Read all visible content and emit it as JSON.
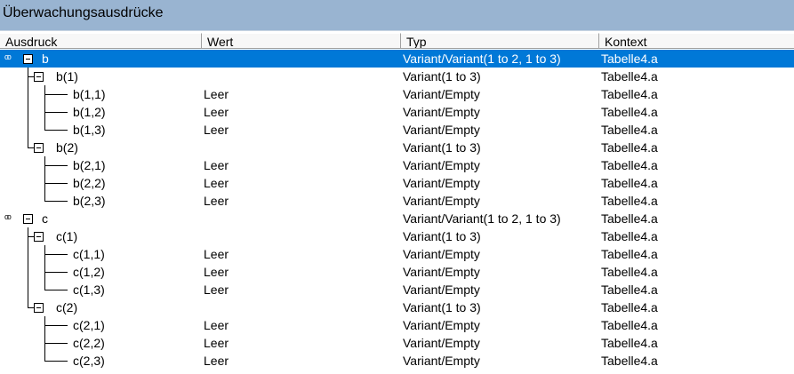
{
  "window": {
    "title": "Überwachungsausdrücke"
  },
  "columns": [
    "Ausdruck",
    "Wert",
    "Typ",
    "Kontext"
  ],
  "glasses_glyph": "ᵒᵒ",
  "rows": [
    {
      "name": "b",
      "value": "",
      "type": "Variant/Variant(1 to 2, 1 to 3)",
      "context": "Tabelle4.a",
      "level": 0,
      "selected": true
    },
    {
      "name": "b(1)",
      "value": "",
      "type": "Variant(1 to 3)",
      "context": "Tabelle4.a",
      "level": 1
    },
    {
      "name": "b(1,1)",
      "value": "Leer",
      "type": "Variant/Empty",
      "context": "Tabelle4.a",
      "level": 2
    },
    {
      "name": "b(1,2)",
      "value": "Leer",
      "type": "Variant/Empty",
      "context": "Tabelle4.a",
      "level": 2
    },
    {
      "name": "b(1,3)",
      "value": "Leer",
      "type": "Variant/Empty",
      "context": "Tabelle4.a",
      "level": 2
    },
    {
      "name": "b(2)",
      "value": "",
      "type": "Variant(1 to 3)",
      "context": "Tabelle4.a",
      "level": 1
    },
    {
      "name": "b(2,1)",
      "value": "Leer",
      "type": "Variant/Empty",
      "context": "Tabelle4.a",
      "level": 2
    },
    {
      "name": "b(2,2)",
      "value": "Leer",
      "type": "Variant/Empty",
      "context": "Tabelle4.a",
      "level": 2
    },
    {
      "name": "b(2,3)",
      "value": "Leer",
      "type": "Variant/Empty",
      "context": "Tabelle4.a",
      "level": 2
    },
    {
      "name": "c",
      "value": "",
      "type": "Variant/Variant(1 to 2, 1 to 3)",
      "context": "Tabelle4.a",
      "level": 0
    },
    {
      "name": "c(1)",
      "value": "",
      "type": "Variant(1 to 3)",
      "context": "Tabelle4.a",
      "level": 1
    },
    {
      "name": "c(1,1)",
      "value": "Leer",
      "type": "Variant/Empty",
      "context": "Tabelle4.a",
      "level": 2
    },
    {
      "name": "c(1,2)",
      "value": "Leer",
      "type": "Variant/Empty",
      "context": "Tabelle4.a",
      "level": 2
    },
    {
      "name": "c(1,3)",
      "value": "Leer",
      "type": "Variant/Empty",
      "context": "Tabelle4.a",
      "level": 2
    },
    {
      "name": "c(2)",
      "value": "",
      "type": "Variant(1 to 3)",
      "context": "Tabelle4.a",
      "level": 1
    },
    {
      "name": "c(2,1)",
      "value": "Leer",
      "type": "Variant/Empty",
      "context": "Tabelle4.a",
      "level": 2
    },
    {
      "name": "c(2,2)",
      "value": "Leer",
      "type": "Variant/Empty",
      "context": "Tabelle4.a",
      "level": 2
    },
    {
      "name": "c(2,3)",
      "value": "Leer",
      "type": "Variant/Empty",
      "context": "Tabelle4.a",
      "level": 2
    }
  ],
  "colors": {
    "title_bar": "#99b4d1",
    "selection": "#0078d7"
  }
}
